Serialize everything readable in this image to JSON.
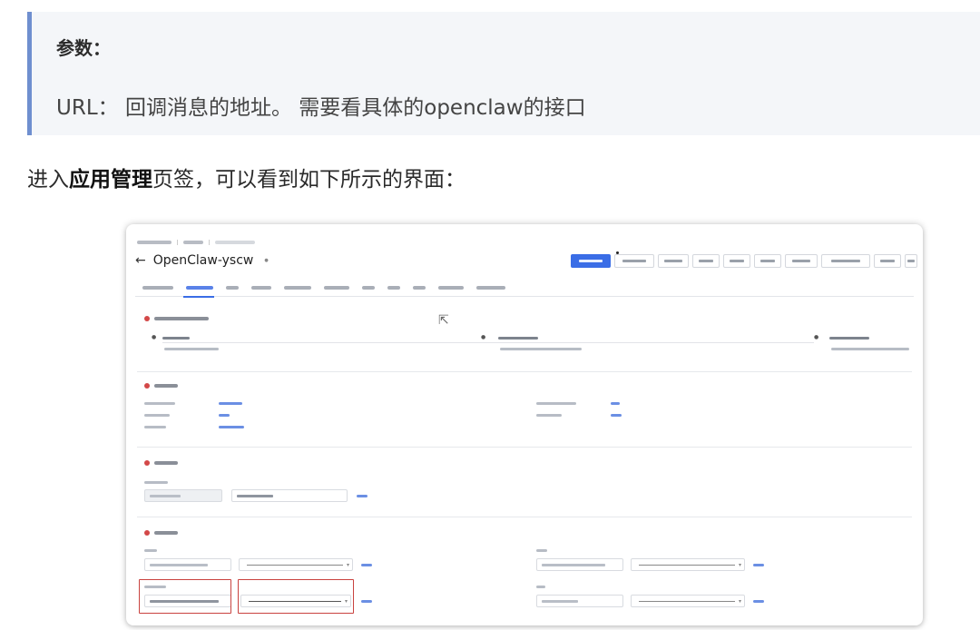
{
  "callout": {
    "title": "参数：",
    "body": "URL： 回调消息的地址。 需要看具体的openclaw的接口"
  },
  "paragraph": {
    "prefix": "进入",
    "bold": "应用管理",
    "suffix": "页签，可以看到如下所示的界面："
  },
  "screenshot": {
    "app_name": "OpenClaw-yscw",
    "back_icon": "arrow-left-icon",
    "colors": {
      "primary": "#3a6de6",
      "highlight": "#c9423f",
      "section_icon": "#d34848"
    }
  }
}
